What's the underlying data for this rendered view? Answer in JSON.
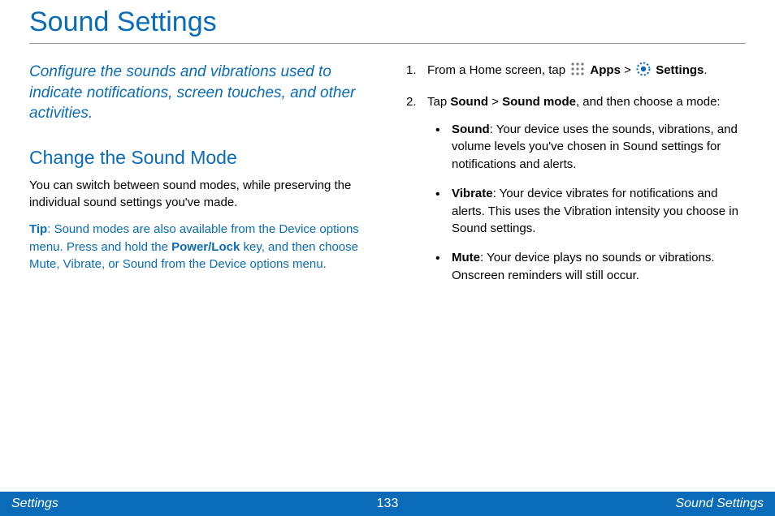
{
  "title": "Sound Settings",
  "subtitle": "Configure the sounds and vibrations used to indicate notifications, screen touches, and other activities.",
  "section_heading": "Change the Sound Mode",
  "section_para": "You can switch between sound modes, while preserving the individual sound settings you've made.",
  "tip": {
    "label": "Tip",
    "before": ": Sound modes are also available from the Device options menu. Press and hold the ",
    "key": "Power/Lock",
    "after": " key, and then choose Mute, Vibrate, or Sound from the Device options menu."
  },
  "steps": {
    "s1_a": "From a Home screen, tap ",
    "s1_apps": "Apps",
    "s1_b": " > ",
    "s1_settings": "Settings",
    "s1_c": ".",
    "s2_a": "Tap ",
    "s2_sound": "Sound",
    "s2_b": " > ",
    "s2_mode": "Sound mode",
    "s2_c": ", and then choose a mode:"
  },
  "modes": {
    "sound_label": "Sound",
    "sound_text": ": Your device uses the sounds, vibrations, and volume levels you've chosen in Sound settings for notifications and alerts.",
    "vibrate_label": "Vibrate",
    "vibrate_text": ": Your device vibrates for notifications and alerts. This uses the Vibration intensity you choose in Sound settings.",
    "mute_label": "Mute",
    "mute_text": ": Your device plays no sounds or vibrations. Onscreen reminders will still occur."
  },
  "footer": {
    "left": "Settings",
    "center": "133",
    "right": "Sound Settings"
  }
}
